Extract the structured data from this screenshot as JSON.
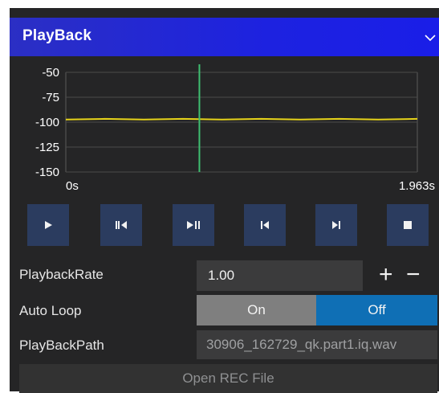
{
  "panel": {
    "title": "PlayBack"
  },
  "chart": {
    "y_ticks": [
      "-50",
      "-75",
      "-100",
      "-125",
      "-150"
    ],
    "x_start": "0s",
    "x_end": "1.963s",
    "line_color": "#e6d31a",
    "cursor_color": "#3fbf70"
  },
  "chart_data": {
    "type": "line",
    "ylim": [
      -150,
      -50
    ],
    "xlim": [
      0,
      1.963
    ],
    "series": [
      {
        "values": [
          -97,
          -97,
          -97,
          -97,
          -97,
          -97,
          -97,
          -97,
          -97,
          -97
        ]
      }
    ],
    "cursor_x_fraction": 0.38
  },
  "controls": {
    "buttons": [
      "play-icon",
      "step-back-icon",
      "play-pause-icon",
      "skip-back-icon",
      "skip-forward-icon",
      "stop-icon"
    ]
  },
  "form": {
    "rate_label": "PlaybackRate",
    "rate_value": "1.00",
    "plus": "+",
    "minus": "−",
    "loop_label": "Auto Loop",
    "loop_on": "On",
    "loop_off": "Off",
    "loop_selected": "Off",
    "path_label": "PlayBackPath",
    "path_value": "30906_162729_qk.part1.iq.wav",
    "open_button": "Open REC File"
  },
  "colors": {
    "panel_bg": "#252526",
    "title_bar": "#1d22e0",
    "toggle_on_bg": "#7f7f7f",
    "toggle_off_bg": "#0f6fb5"
  }
}
